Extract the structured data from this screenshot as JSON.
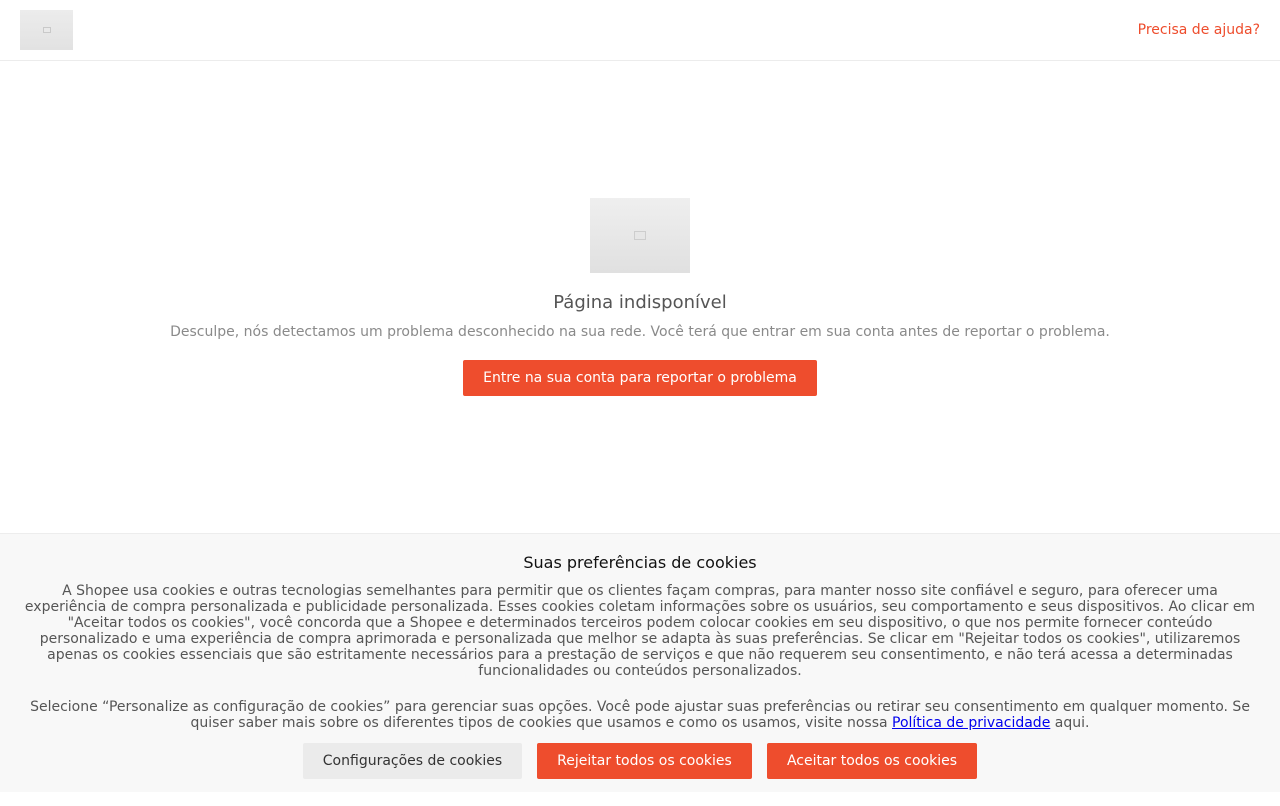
{
  "header": {
    "logo_icon": "shopee-logo-image",
    "help_link": "Precisa de ajuda?"
  },
  "main": {
    "image_icon": "error-illustration-image",
    "title": "Página indisponível",
    "description": "Desculpe, nós detectamos um problema desconhecido na sua rede. Você terá que entrar em sua conta antes de reportar o problema.",
    "login_button": "Entre na sua conta para reportar o problema"
  },
  "cookies": {
    "title": "Suas preferências de cookies",
    "paragraph1": "A Shopee usa cookies e outras tecnologias semelhantes para permitir que os clientes façam compras, para manter nosso site confiável e seguro, para oferecer uma experiência de compra personalizada e publicidade personalizada. Esses cookies coletam informações sobre os usuários, seu comportamento e seus dispositivos. Ao clicar em \"Aceitar todos os cookies\", você concorda que a Shopee e determinados terceiros podem colocar cookies em seu dispositivo, o que nos permite fornecer conteúdo personalizado e uma experiência de compra aprimorada e personalizada que melhor se adapta às suas preferências. Se clicar em \"Rejeitar todos os cookies\", utilizaremos apenas os cookies essenciais que são estritamente necessários para a prestação de serviços e que não requerem seu consentimento, e não terá acessa a determinadas funcionalidades ou conteúdos personalizados.",
    "paragraph2_before": "Selecione “Personalize as configuração de cookies” para gerenciar suas opções. Você pode ajustar suas preferências ou retirar seu consentimento em qualquer momento. Se quiser saber mais sobre os diferentes tipos de cookies que usamos e como os usamos, visite nossa ",
    "privacy_link": "Política de privacidade",
    "paragraph2_after": " aqui.",
    "settings_button": "Configurações de cookies",
    "reject_button": "Rejeitar todos os cookies",
    "accept_button": "Aceitar todos os cookies"
  },
  "colors": {
    "accent": "#ee4d2d",
    "link": "#0000ee",
    "banner_background": "#f8f8f8"
  }
}
